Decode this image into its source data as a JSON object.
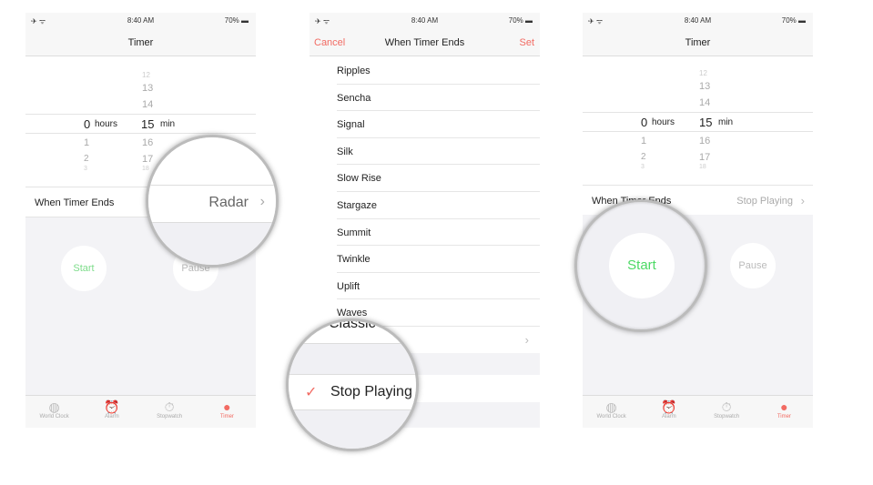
{
  "status": {
    "time": "8:40 AM",
    "battery": "70%",
    "left_icons": "✈ ᯤ"
  },
  "picker": {
    "hours_above": [],
    "hours_selected": "0",
    "hours_unit": "hours",
    "hours_below": [
      "1",
      "2",
      "3"
    ],
    "min_above": [
      "12",
      "13",
      "14"
    ],
    "min_selected": "15",
    "min_unit": "min",
    "min_below": [
      "16",
      "17",
      "18"
    ]
  },
  "panel1": {
    "title": "Timer",
    "when_label": "When Timer Ends",
    "when_value": "Radar",
    "start": "Start",
    "pause": "Pause"
  },
  "panel2": {
    "cancel": "Cancel",
    "title": "When Timer Ends",
    "set": "Set",
    "sounds": [
      "Ripples",
      "Sencha",
      "Signal",
      "Silk",
      "Slow Rise",
      "Stargaze",
      "Summit",
      "Twinkle",
      "Uplift",
      "Waves"
    ],
    "classic": "Classic",
    "stop_playing": "Stop Playing"
  },
  "panel3": {
    "title": "Timer",
    "when_label": "When Timer Ends",
    "when_value": "Stop Playing",
    "start": "Start",
    "pause": "Pause"
  },
  "tabs": [
    {
      "label": "World Clock",
      "icon": "globe-icon"
    },
    {
      "label": "Alarm",
      "icon": "alarm-icon"
    },
    {
      "label": "Stopwatch",
      "icon": "stopwatch-icon"
    },
    {
      "label": "Timer",
      "icon": "timer-icon"
    }
  ],
  "colors": {
    "accent": "#f26b63",
    "start_green": "#4cd964"
  }
}
